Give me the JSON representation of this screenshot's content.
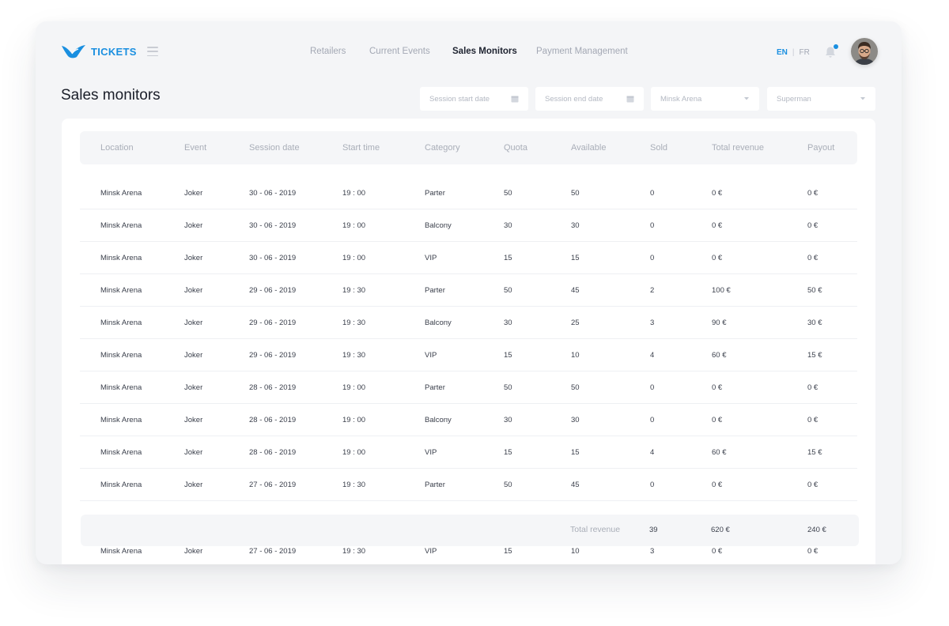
{
  "app": {
    "logo_text": "TICKETS",
    "accent": "#1a8fe0"
  },
  "nav": {
    "items": [
      {
        "label": "Retailers",
        "active": false
      },
      {
        "label": "Current Events",
        "active": false
      },
      {
        "label": "Sales Monitors",
        "active": true
      },
      {
        "label": "Payment Management",
        "active": false
      }
    ]
  },
  "lang": {
    "en": "EN",
    "sep": "|",
    "fr": "FR",
    "selected": "EN"
  },
  "page": {
    "title": "Sales monitors"
  },
  "filters": {
    "start_date": {
      "placeholder": "Session start date",
      "icon": "calendar-icon"
    },
    "end_date": {
      "placeholder": "Session end date",
      "icon": "calendar-icon"
    },
    "location": {
      "value": "Minsk Arena",
      "icon": "chevron-down-icon"
    },
    "event": {
      "value": "Superman",
      "icon": "chevron-down-icon"
    }
  },
  "table": {
    "columns": [
      "Location",
      "Event",
      "Session date",
      "Start time",
      "Category",
      "Quota",
      "Available",
      "Sold",
      "Total revenue",
      "Payout"
    ],
    "rows": [
      [
        "Minsk Arena",
        "Joker",
        "30 - 06 - 2019",
        "19 : 00",
        "Parter",
        "50",
        "50",
        "0",
        "0 €",
        "0 €"
      ],
      [
        "Minsk Arena",
        "Joker",
        "30 - 06 - 2019",
        "19 : 00",
        "Balcony",
        "30",
        "30",
        "0",
        "0 €",
        "0 €"
      ],
      [
        "Minsk Arena",
        "Joker",
        "30 - 06 - 2019",
        "19 : 00",
        "VIP",
        "15",
        "15",
        "0",
        "0 €",
        "0 €"
      ],
      [
        "Minsk Arena",
        "Joker",
        "29 - 06 - 2019",
        "19 : 30",
        "Parter",
        "50",
        "45",
        "2",
        "100 €",
        "50 €"
      ],
      [
        "Minsk Arena",
        "Joker",
        "29 - 06 - 2019",
        "19 : 30",
        "Balcony",
        "30",
        "25",
        "3",
        "90 €",
        "30 €"
      ],
      [
        "Minsk Arena",
        "Joker",
        "29 - 06 - 2019",
        "19 : 30",
        "VIP",
        "15",
        "10",
        "4",
        "60 €",
        "15 €"
      ],
      [
        "Minsk Arena",
        "Joker",
        "28 - 06 - 2019",
        "19 : 00",
        "Parter",
        "50",
        "50",
        "0",
        "0 €",
        "0 €"
      ],
      [
        "Minsk Arena",
        "Joker",
        "28 - 06 - 2019",
        "19 : 00",
        "Balcony",
        "30",
        "30",
        "0",
        "0 €",
        "0 €"
      ],
      [
        "Minsk Arena",
        "Joker",
        "28 - 06 - 2019",
        "19 : 00",
        "VIP",
        "15",
        "15",
        "4",
        "60 €",
        "15 €"
      ],
      [
        "Minsk Arena",
        "Joker",
        "27 - 06 - 2019",
        "19 : 30",
        "Parter",
        "50",
        "45",
        "0",
        "0 €",
        "0 €"
      ]
    ],
    "last_row": [
      "Minsk Arena",
      "Joker",
      "27 - 06 - 2019",
      "19 : 30",
      "VIP",
      "15",
      "10",
      "3",
      "0 €",
      "0 €"
    ],
    "totals": {
      "label": "Total revenue",
      "sold": "39",
      "revenue": "620 €",
      "payout": "240 €"
    }
  }
}
